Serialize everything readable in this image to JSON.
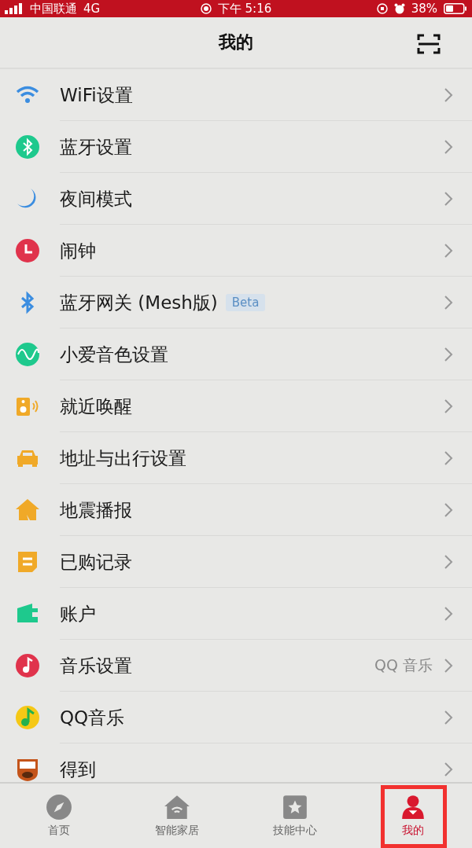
{
  "status_bar": {
    "carrier": "中国联通",
    "network": "4G",
    "time": "下午 5:16",
    "battery": "38%"
  },
  "header": {
    "title": "我的"
  },
  "items": [
    {
      "label": "WiFi设置"
    },
    {
      "label": "蓝牙设置"
    },
    {
      "label": "夜间模式"
    },
    {
      "label": "闹钟"
    },
    {
      "label": "蓝牙网关 (Mesh版)",
      "badge": "Beta"
    },
    {
      "label": "小爱音色设置"
    },
    {
      "label": "就近唤醒"
    },
    {
      "label": "地址与出行设置"
    },
    {
      "label": "地震播报"
    },
    {
      "label": "已购记录"
    },
    {
      "label": "账户"
    },
    {
      "label": "音乐设置",
      "value": "QQ 音乐"
    },
    {
      "label": "QQ音乐"
    },
    {
      "label": "得到"
    }
  ],
  "tabs": [
    {
      "label": "首页",
      "selected": false
    },
    {
      "label": "智能家居",
      "selected": false
    },
    {
      "label": "技能中心",
      "selected": false
    },
    {
      "label": "我的",
      "selected": true
    }
  ]
}
